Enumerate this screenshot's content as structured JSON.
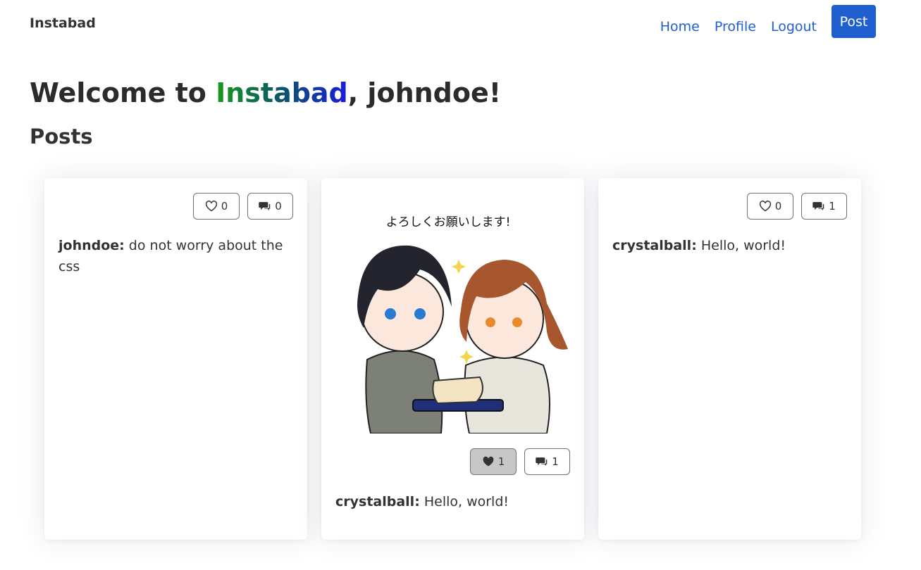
{
  "navbar": {
    "brand": "Instabad",
    "links": [
      "Home",
      "Profile",
      "Logout"
    ],
    "post_button": "Post"
  },
  "welcome": {
    "prefix": "Welcome to ",
    "brand": "Instabad",
    "suffix": ", johndoe!"
  },
  "section_title": "Posts",
  "colors": {
    "accent": "#1f5fd0",
    "brand_gradient": [
      "#1b9a1b",
      "#0a5b62",
      "#1a1ad9"
    ]
  },
  "posts": [
    {
      "author": "johndoe:",
      "text": " do not worry about the css",
      "likes": "0",
      "comments": "0",
      "liked": false,
      "has_image": false
    },
    {
      "author": "crystalball:",
      "text": " Hello, world!",
      "likes": "1",
      "comments": "1",
      "liked": true,
      "has_image": true,
      "image_caption": "よろしくお願いします!"
    },
    {
      "author": "crystalball:",
      "text": " Hello, world!",
      "likes": "0",
      "comments": "1",
      "liked": false,
      "has_image": false
    }
  ],
  "icons": {
    "like": "heart-icon",
    "comment": "chat-bubbles-icon"
  }
}
